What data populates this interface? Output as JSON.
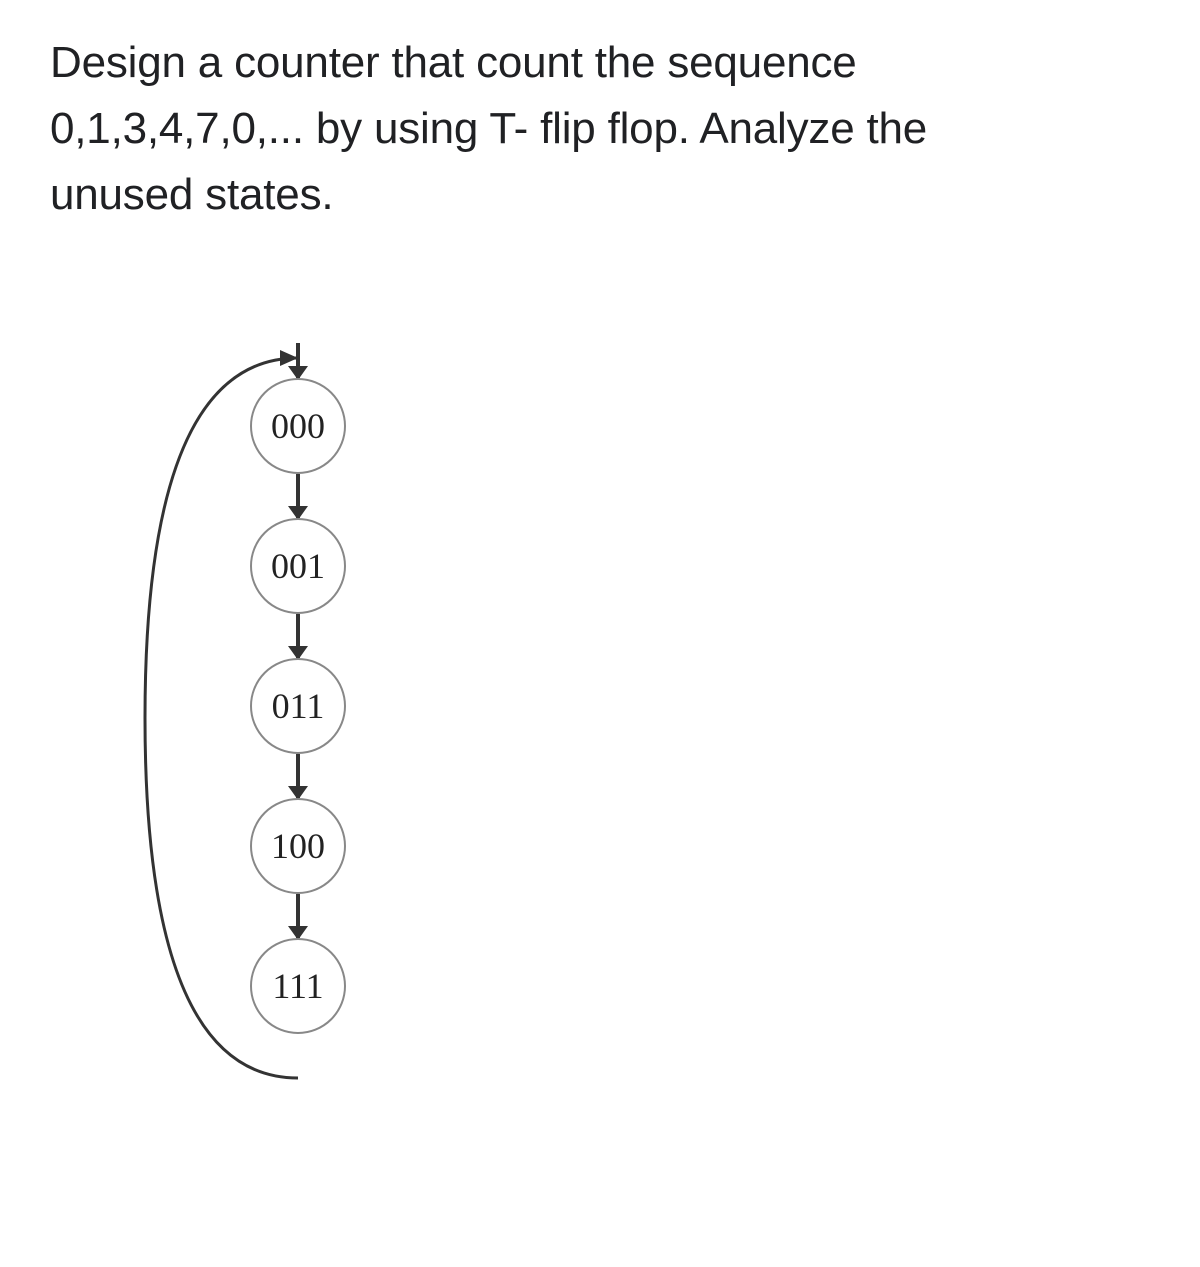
{
  "question": {
    "line1": "Design a counter that count the sequence",
    "line2": "0,1,3,4,7,0,... by using T- flip flop. Analyze the",
    "line3": "unused states."
  },
  "diagram": {
    "states": [
      "000",
      "001",
      "011",
      "100",
      "111"
    ]
  }
}
